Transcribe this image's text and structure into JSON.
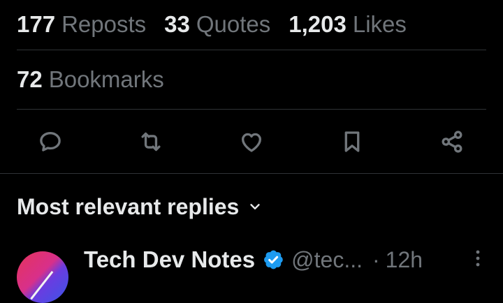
{
  "engagement": {
    "reposts": {
      "count": "177",
      "label": "Reposts"
    },
    "quotes": {
      "count": "33",
      "label": "Quotes"
    },
    "likes": {
      "count": "1,203",
      "label": "Likes"
    },
    "bookmarks": {
      "count": "72",
      "label": "Bookmarks"
    }
  },
  "actions": {
    "reply_icon": "reply-bubble-icon",
    "repost_icon": "repost-arrows-icon",
    "like_icon": "heart-icon",
    "bookmark_icon": "bookmark-icon",
    "share_icon": "share-icon"
  },
  "replies": {
    "sort_label": "Most relevant replies"
  },
  "first_reply": {
    "author_name": "Tech Dev Notes",
    "handle": "@tec...",
    "separator": "·",
    "time": "12h",
    "verified": true
  },
  "colors": {
    "background": "#000000",
    "primary_text": "#e7e9ea",
    "secondary_text": "#71767b",
    "divider": "#2f3336",
    "verified_blue": "#1d9bf0"
  }
}
